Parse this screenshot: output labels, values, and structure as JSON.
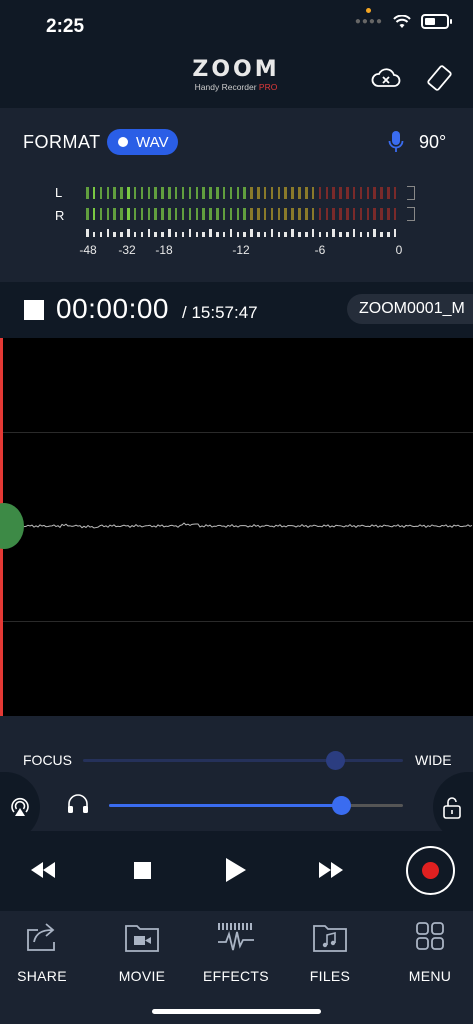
{
  "status_bar": {
    "time": "2:25",
    "signal_icon": "signal-dots-icon",
    "wifi_icon": "wifi-icon",
    "battery_icon": "battery-icon"
  },
  "header": {
    "logo_text": "ZOOM",
    "logo_subtitle": "Handy Recorder",
    "logo_subtitle_accent": "PRO",
    "cloud_icon": "cloud-off-icon",
    "rotate_icon": "screen-rotation-icon"
  },
  "format": {
    "label": "FORMAT",
    "value": "WAV",
    "mic_icon": "microphone-icon",
    "angle": "90°"
  },
  "level_meter": {
    "channels": [
      "L",
      "R"
    ],
    "scale": [
      "-48",
      "-32",
      "-18",
      "-12",
      "-6",
      "0"
    ],
    "colors": {
      "low": "#7ac943",
      "mid": "#8a7a2a",
      "high": "#7a2a2a"
    }
  },
  "recording": {
    "counter": "00:00:00",
    "remaining": "/ 15:57:47",
    "file_name": "ZOOM0001_M"
  },
  "mic_controls": {
    "focus_label": "FOCUS",
    "wide_label": "WIDE",
    "focus_level": 0.79,
    "volume_level": 0.79,
    "headphone_icon": "headphones-icon",
    "airplay_icon": "airplay-icon",
    "lock_icon": "unlock-icon"
  },
  "transport": {
    "rewind_icon": "rewind-icon",
    "stop_icon": "stop-icon",
    "play_icon": "play-icon",
    "ffwd_icon": "fast-forward-icon",
    "record_icon": "record-icon",
    "record_color": "#e02020"
  },
  "tabs": [
    {
      "label": "SHARE",
      "icon": "share-icon"
    },
    {
      "label": "MOVIE",
      "icon": "movie-folder-icon"
    },
    {
      "label": "EFFECTS",
      "icon": "effects-icon"
    },
    {
      "label": "FILES",
      "icon": "files-folder-icon"
    },
    {
      "label": "MENU",
      "icon": "menu-grid-icon"
    }
  ],
  "accent_color": "#2a5ee6"
}
